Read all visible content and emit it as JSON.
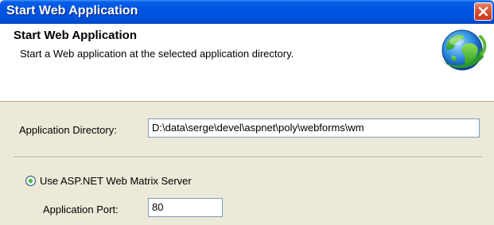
{
  "window": {
    "title": "Start Web Application"
  },
  "header": {
    "title": "Start Web Application",
    "subtitle": "Start a Web application at the selected application directory.",
    "icon": "globe-icon"
  },
  "form": {
    "directory_label": "Application Directory:",
    "directory_value": "D:\\data\\serge\\devel\\aspnet\\poly\\webforms\\wm",
    "server_option_label": "Use ASP.NET Web Matrix Server",
    "server_option_selected": true,
    "port_label": "Application Port:",
    "port_value": "80"
  },
  "colors": {
    "titlebar": "#0054E3",
    "dialog_bg": "#ECE9D8",
    "close_button": "#D9522F"
  }
}
